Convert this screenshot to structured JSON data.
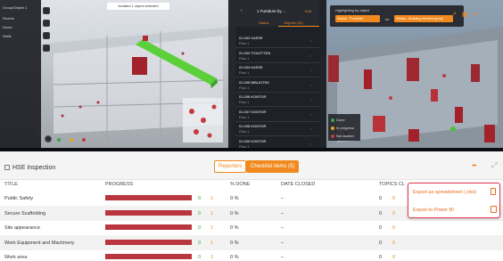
{
  "viewer_left": {
    "sidebar_items": [
      "Group/Objekt 1",
      "Rooms",
      "Doors",
      "Walls"
    ],
    "top_banner": "Isolated 1 object selected"
  },
  "objects_panel": {
    "title": "1 Furniture by ...",
    "edit_label": "Edit",
    "tabs": [
      "Status",
      "Objects (32)"
    ],
    "items": [
      {
        "code": "01.002 KASSE",
        "sub": "Plan 1"
      },
      {
        "code": "01.003 TOILETTEN",
        "sub": "Plan 1"
      },
      {
        "code": "01.004 KASSE",
        "sub": "Plan 1"
      },
      {
        "code": "01.005 BIBLIOTEK",
        "sub": "Plan 1"
      },
      {
        "code": "01.006 KONTOR",
        "sub": "Plan 1"
      },
      {
        "code": "01.007 KONTOR",
        "sub": "Plan 1"
      },
      {
        "code": "01.008 KONTOR",
        "sub": "Plan 1"
      },
      {
        "code": "01.009 KONTOR",
        "sub": "Plan 1"
      }
    ]
  },
  "viewer_right": {
    "highlight_label": "Highlighting by object",
    "filter1": "Status - Furniture",
    "on_label": "on",
    "filter2": "Status - Building element group",
    "legend": [
      "Done",
      "In progress",
      "Not started"
    ]
  },
  "checklist": {
    "title": "HSE Inspection",
    "tabs": {
      "reports": "Reporters",
      "items": "Checklist items (5)"
    },
    "columns": {
      "title": "TITLE",
      "progress": "PROGRESS",
      "done": "% DONE",
      "date": "DATE CLOSED",
      "topics": "TOPICS CL"
    },
    "rows": [
      {
        "title": "Public Safety",
        "green": "0",
        "orange": "1",
        "done": "0 %",
        "date": "–",
        "t1": "0",
        "t2": "0"
      },
      {
        "title": "Secure Scaffolding",
        "green": "0",
        "orange": "1",
        "done": "0 %",
        "date": "–",
        "t1": "0",
        "t2": "0"
      },
      {
        "title": "Site appearance",
        "green": "0",
        "orange": "1",
        "done": "0 %",
        "date": "–",
        "t1": "0",
        "t2": "0"
      },
      {
        "title": "Work Equipment and Machinery",
        "green": "0",
        "orange": "1",
        "done": "0 %",
        "date": "–",
        "t1": "0",
        "t2": "0"
      },
      {
        "title": "Work area",
        "green": "0",
        "orange": "1",
        "done": "0 %",
        "date": "–",
        "t1": "0",
        "t2": "0"
      }
    ],
    "menu": {
      "export_xlsx": "Export as spreadsheet (.xlsx)",
      "export_powerbi": "Export to Power BI"
    },
    "more_label": "•••"
  },
  "colors": {
    "accent": "#f08a1e",
    "bar": "#b9363e",
    "done": "#3fa33f",
    "alert": "#e3354b"
  }
}
